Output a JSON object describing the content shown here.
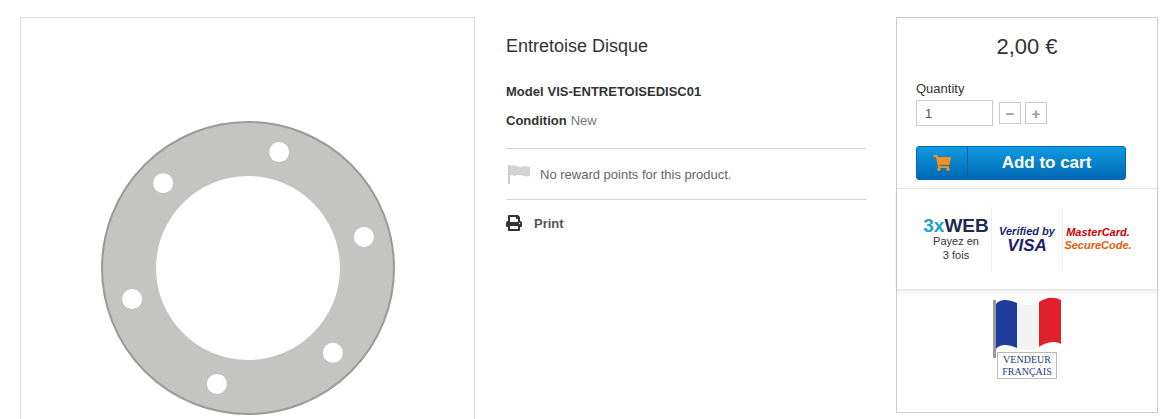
{
  "product": {
    "title": "Entretoise Disque",
    "model_label": "Model",
    "model": "VIS-ENTRETOISEDISC01",
    "condition_label": "Condition",
    "condition": "New"
  },
  "reward": {
    "text": "No reward points for this product."
  },
  "print": {
    "label": "Print"
  },
  "buy_box": {
    "price": "2,00 €",
    "quantity_label": "Quantity",
    "quantity": "1",
    "minus": "−",
    "plus": "+",
    "add_to_cart": "Add to cart"
  },
  "payment": {
    "threexweb": {
      "prefix": "3x",
      "brand": "WEB",
      "caption": [
        "Payez en",
        "3 fois"
      ]
    },
    "visa": {
      "top": "Verified by",
      "brand": "VISA"
    },
    "mastercard": {
      "top": "MasterCard.",
      "bottom": "SecureCode."
    }
  },
  "seller_badge": {
    "lines": [
      "VENDEUR",
      "FRANÇAIS"
    ]
  }
}
